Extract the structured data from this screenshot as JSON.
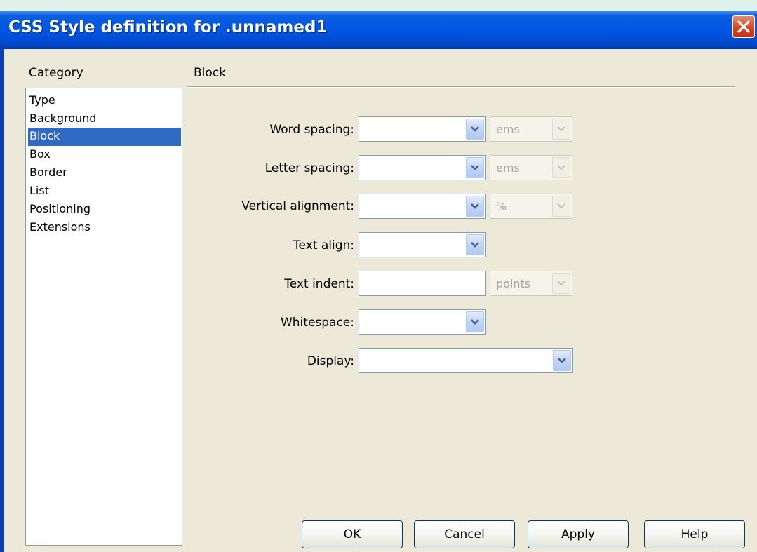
{
  "window": {
    "title": "CSS Style definition for .unnamed1"
  },
  "category": {
    "label": "Category",
    "items": [
      "Type",
      "Background",
      "Block",
      "Box",
      "Border",
      "List",
      "Positioning",
      "Extensions"
    ],
    "selected": "Block"
  },
  "section": {
    "title": "Block"
  },
  "fields": {
    "word_spacing": {
      "label": "Word spacing:",
      "value": "",
      "unit": "ems"
    },
    "letter_spacing": {
      "label": "Letter spacing:",
      "value": "",
      "unit": "ems"
    },
    "vertical_alignment": {
      "label": "Vertical alignment:",
      "value": "",
      "unit": "%"
    },
    "text_align": {
      "label": "Text align:",
      "value": ""
    },
    "text_indent": {
      "label": "Text indent:",
      "value": "",
      "unit": "points"
    },
    "whitespace": {
      "label": "Whitespace:",
      "value": ""
    },
    "display": {
      "label": "Display:",
      "value": ""
    }
  },
  "buttons": {
    "ok": "OK",
    "cancel": "Cancel",
    "apply": "Apply",
    "help": "Help"
  },
  "colors": {
    "titlebar": "#0054e3",
    "selection": "#316ac5",
    "dialog_bg": "#ece9d8",
    "close": "#d7421c"
  },
  "icons": {
    "close": "close-icon",
    "dropdown": "chevron-down-icon"
  }
}
